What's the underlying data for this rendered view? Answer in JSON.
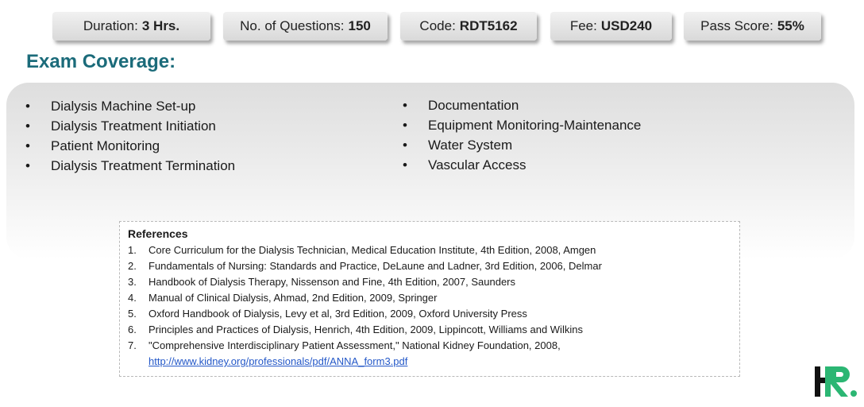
{
  "info_bar": [
    {
      "label": "Duration:",
      "value": "3 Hrs."
    },
    {
      "label": "No. of Questions:",
      "value": "150"
    },
    {
      "label": "Code:",
      "value": "RDT5162"
    },
    {
      "label": "Fee:",
      "value": "USD240"
    },
    {
      "label": "Pass Score:",
      "value": "55%"
    }
  ],
  "coverage": {
    "heading": "Exam Coverage:",
    "bullet": "•",
    "left": [
      "Dialysis Machine Set-up",
      "Dialysis Treatment Initiation",
      "Patient Monitoring",
      "Dialysis Treatment Termination"
    ],
    "right": [
      "Documentation",
      "Equipment Monitoring-Maintenance",
      "Water System",
      "Vascular Access"
    ]
  },
  "references": {
    "title": "References",
    "items": [
      {
        "num": "1.",
        "text": "Core Curriculum for the Dialysis Technician, Medical Education Institute, 4th Edition, 2008, Amgen"
      },
      {
        "num": "2.",
        "text": "Fundamentals of Nursing: Standards and Practice, DeLaune and Ladner, 3rd Edition, 2006, Delmar"
      },
      {
        "num": "3.",
        "text": "Handbook of Dialysis Therapy, Nissenson and Fine, 4th Edition, 2007, Saunders"
      },
      {
        "num": "4.",
        "text": "Manual of Clinical Dialysis, Ahmad, 2nd Edition, 2009, Springer"
      },
      {
        "num": "5.",
        "text": "Oxford Handbook of Dialysis, Levy et al, 3rd Edition, 2009, Oxford University Press"
      },
      {
        "num": "6.",
        "text": "Principles and Practices of Dialysis, Henrich, 4th Edition, 2009, Lippincott, Williams and Wilkins"
      },
      {
        "num": "7.",
        "text": "\"Comprehensive Interdisciplinary Patient Assessment,\" National Kidney Foundation, 2008,",
        "link": "http://www.kidney.org/professionals/pdf/ANNA_form3.pdf"
      }
    ]
  },
  "colors": {
    "heading": "#1b6b7a",
    "link": "#2458c8",
    "logo_green": "#2bb673"
  },
  "logo": {
    "icon": "hr-logo-icon"
  }
}
